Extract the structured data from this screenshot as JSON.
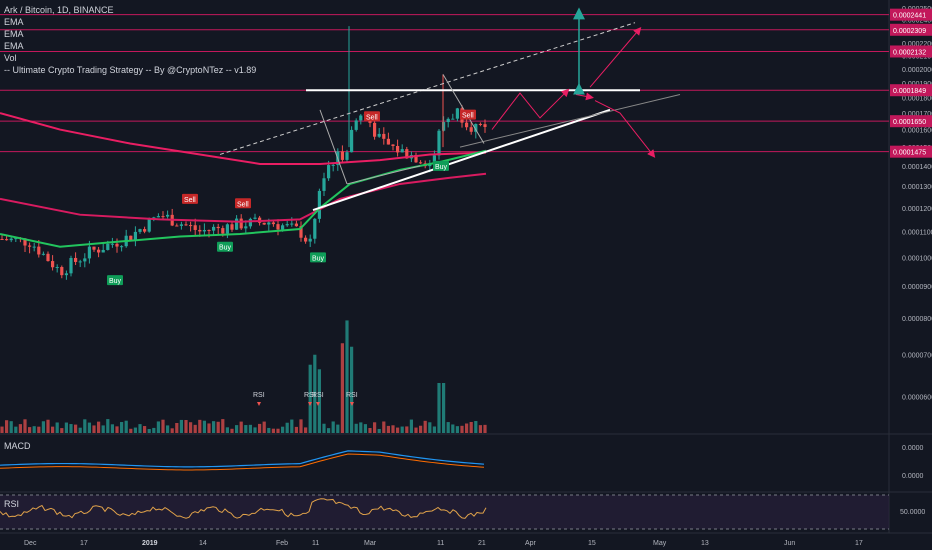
{
  "legend": {
    "symbol": "Ark / Bitcoin, 1D, BINANCE",
    "ema1": "EMA",
    "ema2": "EMA",
    "ema3": "EMA",
    "vol": "Vol",
    "strategy": "-- Ultimate Crypto Trading Strategy -- By @CryptoNTez -- v1.89"
  },
  "panes": {
    "macd_label": "MACD",
    "rsi_label": "RSI"
  },
  "colors": {
    "background": "#131722",
    "up": "#26a69a",
    "down": "#ef5350",
    "ema_fast": "#22c55e",
    "ema_mid": "#e91e63",
    "ema_slow": "#d81b60",
    "level_line": "#c2185b",
    "trend_white": "#ffffff",
    "arrow_red": "#e91e63",
    "arrow_teal": "#26a69a",
    "macd_line": "#2196f3",
    "signal_line": "#ff6d00",
    "rsi_line": "#e0a24a"
  },
  "chart_data": {
    "type": "candlestick",
    "price_axis": {
      "ticks": [
        "0.0002500",
        "0.0002400",
        "0.0002300",
        "0.0002200",
        "0.0002100",
        "0.0002000",
        "0.0001900",
        "0.0001800",
        "0.0001700",
        "0.0001600",
        "0.0001500",
        "0.0001400",
        "0.0001300",
        "0.0001200",
        "0.0001100",
        "0.0001000",
        "0.0000900",
        "0.0000800",
        "0.0000700",
        "0.0000600"
      ],
      "log_scale": true,
      "range": [
        5.5e-05,
        0.000252
      ]
    },
    "level_labels": [
      "0.0002441",
      "0.0002309",
      "0.0002132",
      "0.0001849",
      "0.0001650",
      "0.0001475"
    ],
    "levels": [
      0.0002441,
      0.0002309,
      0.0002132,
      0.0001849,
      0.000165,
      0.0001475
    ],
    "x_labels": [
      "Dec",
      "17",
      "2019",
      "14",
      "Feb",
      "11",
      "Mar",
      "11",
      "21",
      "Apr",
      "15",
      "May",
      "13",
      "Jun",
      "17"
    ],
    "signals": [
      {
        "label": "Sell",
        "type": "sell"
      },
      {
        "label": "Sell",
        "type": "sell"
      },
      {
        "label": "Sell",
        "type": "sell"
      },
      {
        "label": "Sell",
        "type": "sell"
      },
      {
        "label": "Buy",
        "type": "buy"
      },
      {
        "label": "Buy",
        "type": "buy"
      },
      {
        "label": "Buy",
        "type": "buy"
      },
      {
        "label": "Buy",
        "type": "buy"
      }
    ],
    "rsi_markers": [
      "RSI",
      "RSI",
      "RSI",
      "RSI"
    ],
    "macd_axis": [
      "0.0000",
      "0.0000"
    ],
    "rsi_axis": [
      "50.0000"
    ]
  }
}
